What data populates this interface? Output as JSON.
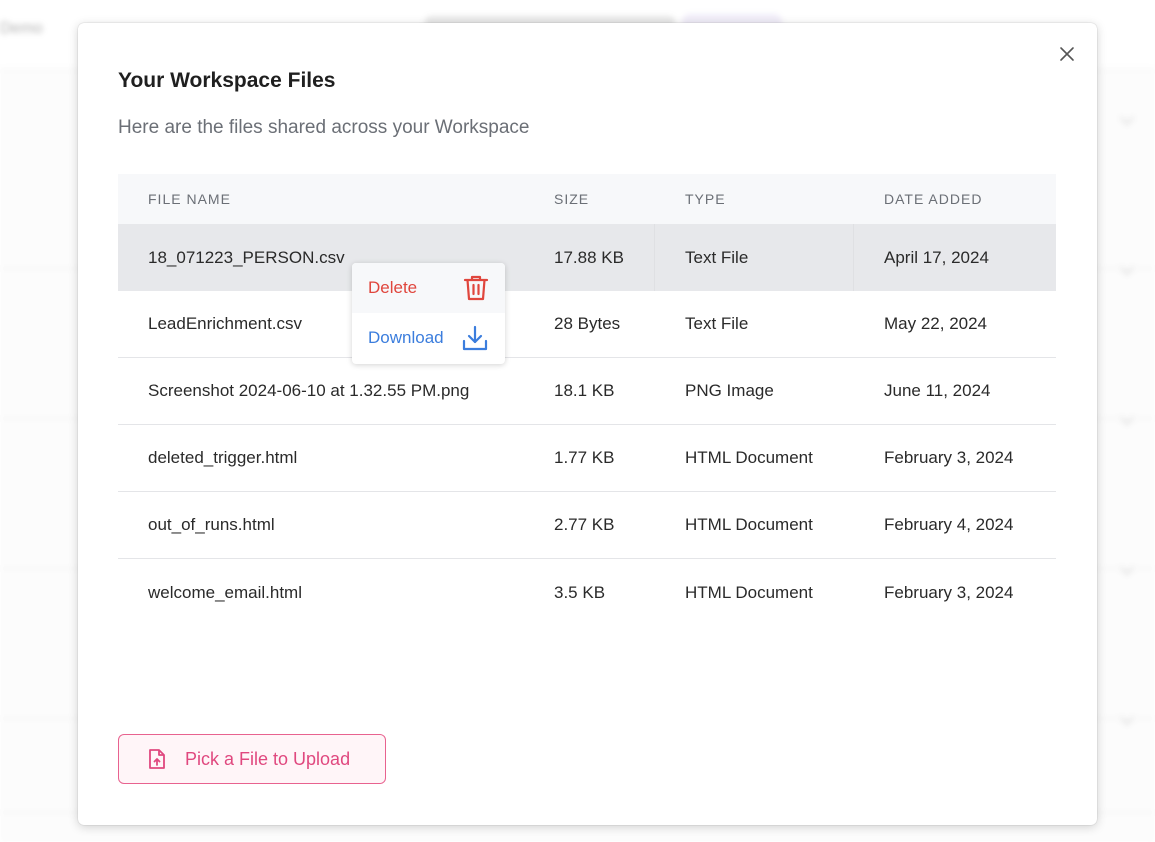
{
  "background": {
    "brand": "Demo"
  },
  "modal": {
    "title": "Your Workspace Files",
    "subtitle": "Here are the files shared across your Workspace",
    "close_icon": "close-icon"
  },
  "table": {
    "headers": [
      "FILE NAME",
      "SIZE",
      "TYPE",
      "DATE ADDED"
    ],
    "rows": [
      {
        "name": "18_071223_PERSON.csv",
        "size": "17.88 KB",
        "type": "Text File",
        "date": "April 17, 2024"
      },
      {
        "name": "LeadEnrichment.csv",
        "size": "28 Bytes",
        "type": "Text File",
        "date": "May 22, 2024"
      },
      {
        "name": "Screenshot 2024-06-10 at 1.32.55 PM.png",
        "size": "18.1 KB",
        "type": "PNG Image",
        "date": "June 11, 2024"
      },
      {
        "name": "deleted_trigger.html",
        "size": "1.77 KB",
        "type": "HTML Document",
        "date": "February 3, 2024"
      },
      {
        "name": "out_of_runs.html",
        "size": "2.77 KB",
        "type": "HTML Document",
        "date": "February 4, 2024"
      },
      {
        "name": "welcome_email.html",
        "size": "3.5 KB",
        "type": "HTML Document",
        "date": "February 3, 2024"
      }
    ]
  },
  "context_menu": {
    "delete_label": "Delete",
    "download_label": "Download",
    "delete_icon": "trash-icon",
    "download_icon": "download-icon"
  },
  "upload": {
    "label": "Pick a File to Upload",
    "icon": "file-upload-icon"
  },
  "colors": {
    "danger": "#e0463d",
    "link": "#3b7ddd",
    "accent": "#e0487f"
  }
}
